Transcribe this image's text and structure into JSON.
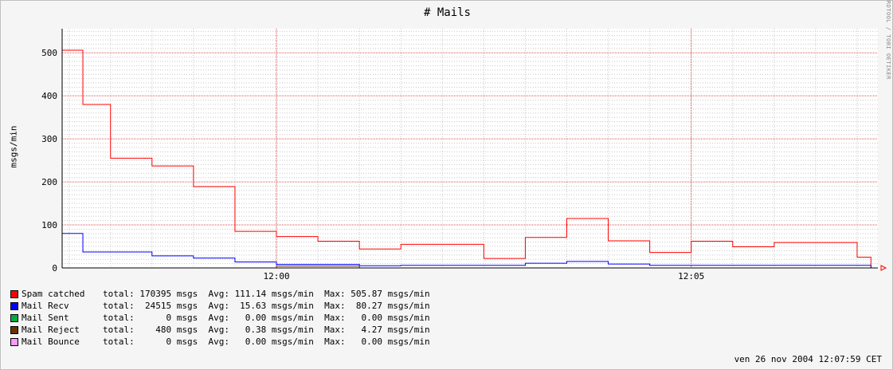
{
  "chart_data": {
    "type": "line",
    "title": "# Mails",
    "ylabel": "msgs/min",
    "xlabel": "",
    "watermark": "RRDTOOL / TOBI OETIKER",
    "ylim": [
      0,
      556
    ],
    "y_ticks": [
      0,
      100,
      200,
      300,
      400,
      500
    ],
    "y_tick_labels": [
      "0",
      "100",
      "200",
      "300",
      "400",
      "500"
    ],
    "x_domain": [
      "11:57:25",
      "12:07:15"
    ],
    "x_ticks": [
      "12:00:00",
      "12:05:00"
    ],
    "x_tick_labels": [
      "12:00",
      "12:05"
    ],
    "grid": true,
    "legend_position": "bottom-left",
    "series": [
      {
        "name": "Spam catched",
        "color": "#ff0000",
        "stats": "total: 170395 msgs  Avg: 111.14 msgs/min  Max: 505.87 msgs/min",
        "x": [
          "11:57:25",
          "11:57:40",
          "11:58:00",
          "11:58:30",
          "11:59:00",
          "11:59:30",
          "12:00:00",
          "12:00:30",
          "12:01:00",
          "12:01:30",
          "12:02:00",
          "12:02:30",
          "12:03:00",
          "12:03:30",
          "12:04:00",
          "12:04:30",
          "12:05:00",
          "12:05:30",
          "12:06:00",
          "12:06:30",
          "12:07:00",
          "12:07:10"
        ],
        "values": [
          505.87,
          380,
          255,
          237,
          189,
          85,
          73,
          62,
          44,
          55,
          55,
          22,
          71,
          115,
          63,
          36,
          62,
          49,
          59,
          59,
          25,
          0
        ]
      },
      {
        "name": "Mail Recv",
        "color": "#0000ff",
        "stats": "total:  24515 msgs  Avg:  15.63 msgs/min  Max:  80.27 msgs/min",
        "x": [
          "11:57:25",
          "11:57:40",
          "11:58:00",
          "11:58:30",
          "11:59:00",
          "11:59:30",
          "12:00:00",
          "12:00:30",
          "12:01:00",
          "12:01:30",
          "12:02:00",
          "12:02:30",
          "12:03:00",
          "12:03:30",
          "12:04:00",
          "12:04:30",
          "12:05:00",
          "12:05:30",
          "12:06:00",
          "12:06:30",
          "12:07:00",
          "12:07:10"
        ],
        "values": [
          80.27,
          37,
          37,
          28,
          23,
          14,
          8,
          8,
          5,
          6,
          6,
          6,
          11,
          15,
          9,
          6,
          6,
          6,
          6,
          6,
          6,
          0
        ]
      },
      {
        "name": "Mail Sent",
        "color": "#00aa44",
        "stats": "total:      0 msgs  Avg:   0.00 msgs/min  Max:   0.00 msgs/min",
        "x": [
          "11:57:25",
          "12:07:10"
        ],
        "values": [
          0,
          0
        ]
      },
      {
        "name": "Mail Reject",
        "color": "#663300",
        "stats": "total:    480 msgs  Avg:   0.38 msgs/min  Max:   4.27 msgs/min",
        "x": [
          "11:57:25",
          "11:59:30",
          "12:00:00",
          "12:01:00",
          "12:01:30",
          "12:07:10"
        ],
        "values": [
          0,
          0,
          4.27,
          0,
          0,
          0
        ]
      },
      {
        "name": "Mail Bounce",
        "color": "#ff99ff",
        "stats": "total:      0 msgs  Avg:   0.00 msgs/min  Max:   0.00 msgs/min",
        "x": [
          "11:57:25",
          "12:07:10"
        ],
        "values": [
          0,
          0
        ]
      }
    ]
  },
  "footer": {
    "timestamp": "ven 26 nov 2004 12:07:59 CET"
  }
}
